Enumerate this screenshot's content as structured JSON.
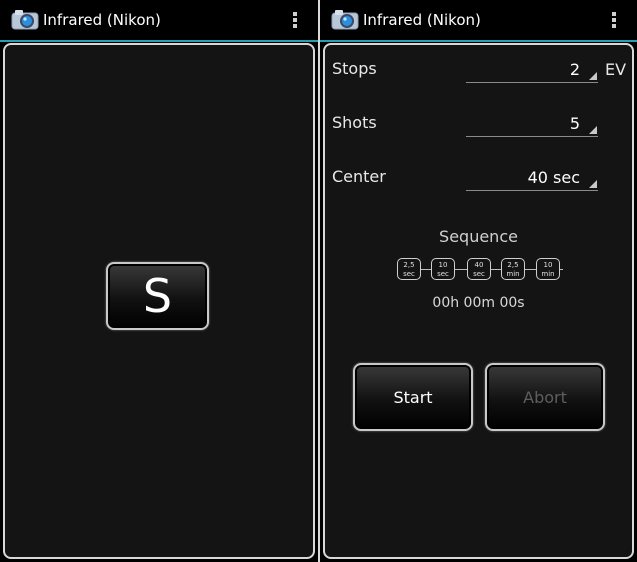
{
  "left_screen": {
    "title": "Infrared (Nikon)",
    "icon": "camera-icon",
    "shutter_button_label": "S"
  },
  "right_screen": {
    "title": "Infrared (Nikon)",
    "icon": "camera-icon",
    "settings": {
      "stops": {
        "label": "Stops",
        "value": "2",
        "unit": "EV"
      },
      "shots": {
        "label": "Shots",
        "value": "5"
      },
      "center": {
        "label": "Center",
        "value": "40 sec"
      }
    },
    "sequence": {
      "title": "Sequence",
      "steps": [
        {
          "value": "2,5",
          "unit": "sec"
        },
        {
          "value": "10",
          "unit": "sec"
        },
        {
          "value": "40",
          "unit": "sec"
        },
        {
          "value": "2,5",
          "unit": "min"
        },
        {
          "value": "10",
          "unit": "min"
        }
      ],
      "elapsed": "00h 00m 00s"
    },
    "buttons": {
      "start": "Start",
      "abort": "Abort"
    }
  },
  "colors": {
    "accent_line": "#2a9fb4",
    "panel_bg": "#141414",
    "disabled_text": "#5e5e5e"
  }
}
